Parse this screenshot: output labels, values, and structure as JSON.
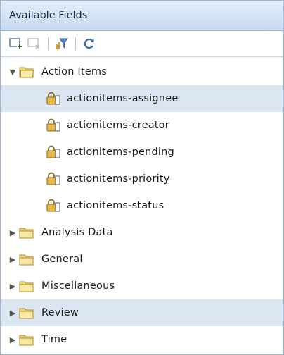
{
  "panel": {
    "title": "Available Fields"
  },
  "toolbar": {
    "buttons": [
      {
        "icon": "add-field-icon"
      },
      {
        "icon": "remove-field-icon"
      },
      {
        "icon": "filter-icon"
      },
      {
        "icon": "refresh-icon"
      }
    ]
  },
  "tree": {
    "groups": [
      {
        "label": "Action Items",
        "expanded": true,
        "items": [
          {
            "label": "actionitems-assignee",
            "selected": true
          },
          {
            "label": "actionitems-creator"
          },
          {
            "label": "actionitems-pending"
          },
          {
            "label": "actionitems-priority"
          },
          {
            "label": "actionitems-status"
          }
        ]
      },
      {
        "label": "Analysis Data",
        "expanded": false
      },
      {
        "label": "General",
        "expanded": false
      },
      {
        "label": "Miscellaneous",
        "expanded": false
      },
      {
        "label": "Review",
        "expanded": false,
        "highlighted": true
      },
      {
        "label": "Time",
        "expanded": false
      }
    ]
  },
  "colors": {
    "header_bg": "#c7d9f0",
    "selection_bg": "#dce6f3",
    "folder_yellow": "#f5d97a"
  }
}
